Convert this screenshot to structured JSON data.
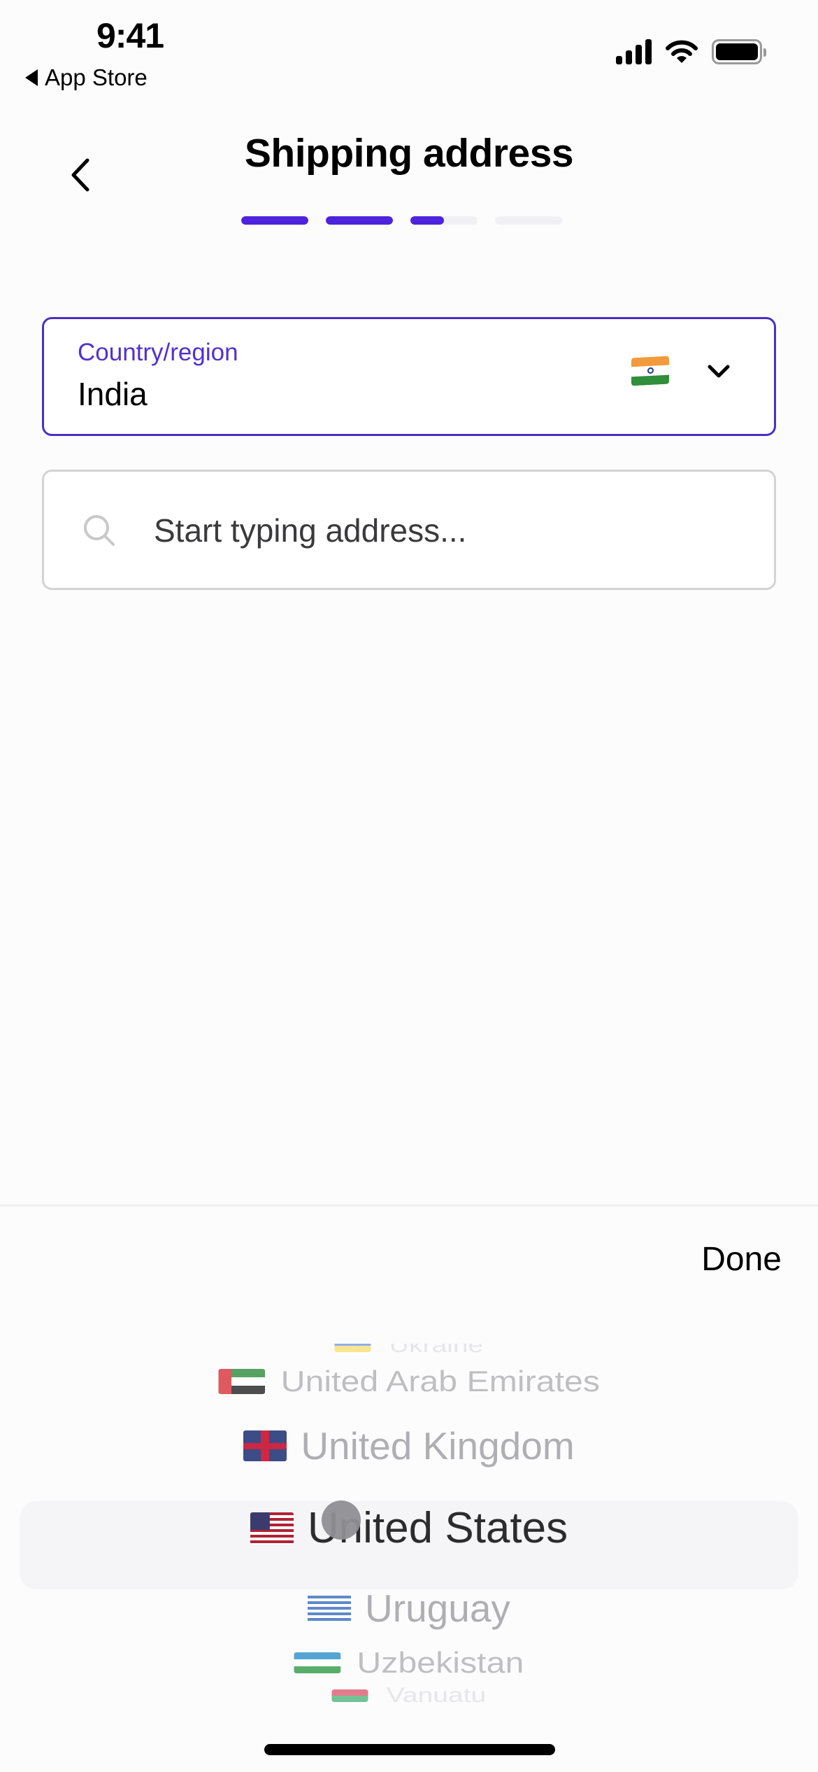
{
  "status_bar": {
    "time": "9:41",
    "back_app_label": "App Store",
    "icons": [
      "signal-icon",
      "wifi-icon",
      "battery-icon"
    ]
  },
  "header": {
    "title": "Shipping address",
    "back_icon": "chevron-left-icon",
    "progress": {
      "steps": 4,
      "fill": [
        1.0,
        1.0,
        0.5,
        0.0
      ],
      "active_color": "#4d23dd",
      "inactive_color": "#f1f0f4"
    }
  },
  "form": {
    "country": {
      "label": "Country/region",
      "value": "India",
      "flag": "flag-india-icon",
      "accent_color": "#5231cf"
    },
    "address": {
      "placeholder": "Start typing address...",
      "value": "",
      "icon": "search-icon"
    }
  },
  "picker": {
    "done_label": "Done",
    "selected": "United States",
    "rows": [
      {
        "name": "Ukraine",
        "flag": "flag-ukraine-icon"
      },
      {
        "name": "United Arab Emirates",
        "flag": "flag-uae-icon"
      },
      {
        "name": "United Kingdom",
        "flag": "flag-uk-icon"
      },
      {
        "name": "United States",
        "flag": "flag-us-icon"
      },
      {
        "name": "Uruguay",
        "flag": "flag-uruguay-icon"
      },
      {
        "name": "Uzbekistan",
        "flag": "flag-uzbekistan-icon"
      },
      {
        "name": "Vanuatu",
        "flag": "flag-vanuatu-icon"
      }
    ]
  }
}
